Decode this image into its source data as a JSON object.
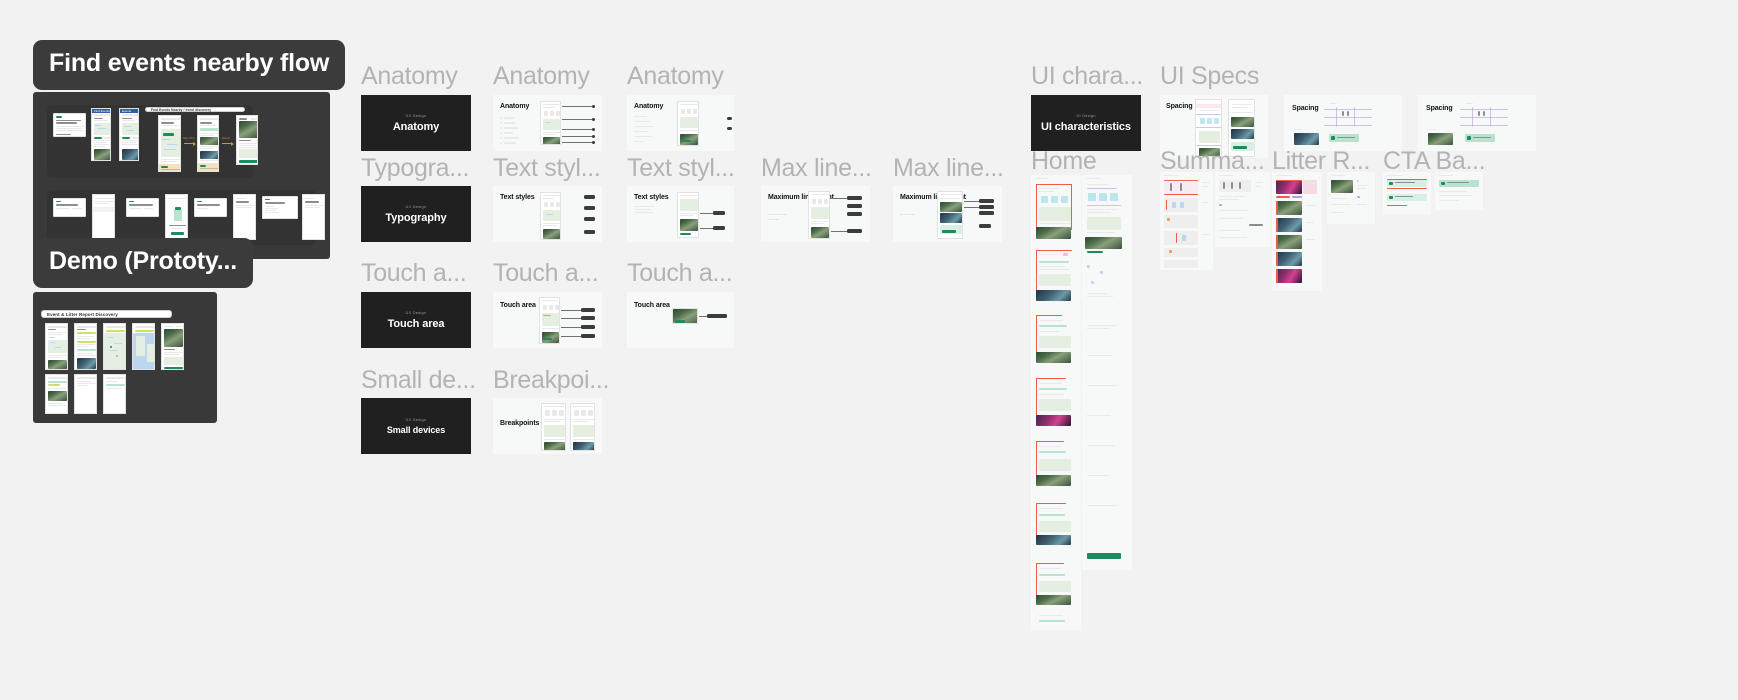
{
  "canvas": {
    "background": "#f2f2f2",
    "label_color": "#b3b3b3",
    "pill_color": "#3b3b3b",
    "dark_card_color": "#202020",
    "accent_green": "#1f8a5d"
  },
  "sections": [
    {
      "id": "find-events",
      "pill": "Find events nearby flow"
    },
    {
      "id": "demo",
      "pill": "Demo (Prototy..."
    }
  ],
  "flow_board": {
    "browser_tab_title": "Find Events Nearby",
    "url_bar_text": "Find Events Nearby / event discovery",
    "arrow_labels": [
      "Tap CTA",
      "Scroll",
      "Select event"
    ]
  },
  "demo_board": {
    "header_title": "Event & Litter Report Discovery"
  },
  "frames": [
    {
      "label": "Anatomy",
      "card_type": "dark",
      "eyebrow": "UX Design",
      "title": "Anatomy"
    },
    {
      "label": "Anatomy",
      "card_type": "light",
      "title": "Anatomy"
    },
    {
      "label": "Anatomy",
      "card_type": "light",
      "title": "Anatomy"
    },
    {
      "label": "Typogra...",
      "card_type": "dark",
      "eyebrow": "UX Design",
      "title": "Typography"
    },
    {
      "label": "Text styl...",
      "card_type": "light",
      "title": "Text styles"
    },
    {
      "label": "Text styl...",
      "card_type": "light",
      "title": "Text styles"
    },
    {
      "label": "Max line...",
      "card_type": "light",
      "title": "Maximum line-count"
    },
    {
      "label": "Max line...",
      "card_type": "light",
      "title": "Maximum line-count"
    },
    {
      "label": "Touch a...",
      "card_type": "dark",
      "eyebrow": "UX Design",
      "title": "Touch area"
    },
    {
      "label": "Touch a...",
      "card_type": "light",
      "title": "Touch area"
    },
    {
      "label": "Touch a...",
      "card_type": "light",
      "title": "Touch area"
    },
    {
      "label": "Small de...",
      "card_type": "dark",
      "eyebrow": "UX Design",
      "title": "Small devices"
    },
    {
      "label": "Breakpoi...",
      "card_type": "light",
      "title": "Breakpoints"
    },
    {
      "label": "UI chara...",
      "card_type": "dark",
      "eyebrow": "UI Design",
      "title": "UI characteristics"
    },
    {
      "label": "UI Specs",
      "card_type": "light",
      "title": "Spacing"
    },
    {
      "label": "Home",
      "card_type": "column"
    },
    {
      "label": "Summa...",
      "card_type": "column"
    },
    {
      "label": "Litter R...",
      "card_type": "column"
    },
    {
      "label": "CTA Ba...",
      "card_type": "column"
    }
  ],
  "spec_cards": {
    "spacing": "Spacing",
    "maximum_line_count": "Maximum\nline-count",
    "text_styles": "Text styles",
    "anatomy": "Anatomy",
    "touch_area": "Touch area",
    "breakpoints": "Breakpoints"
  },
  "labels": {
    "anatomy": "Anatomy",
    "typography_trunc": "Typogra...",
    "text_styles_trunc": "Text styl...",
    "max_line_trunc": "Max line...",
    "touch_area_trunc": "Touch a...",
    "small_devices_trunc": "Small de...",
    "breakpoints_trunc": "Breakpoi...",
    "ui_characteristics_trunc": "UI chara...",
    "ui_specs": "UI Specs",
    "home": "Home",
    "summary_trunc": "Summa...",
    "litter_report_trunc": "Litter R...",
    "cta_bar_trunc": "CTA Ba..."
  }
}
